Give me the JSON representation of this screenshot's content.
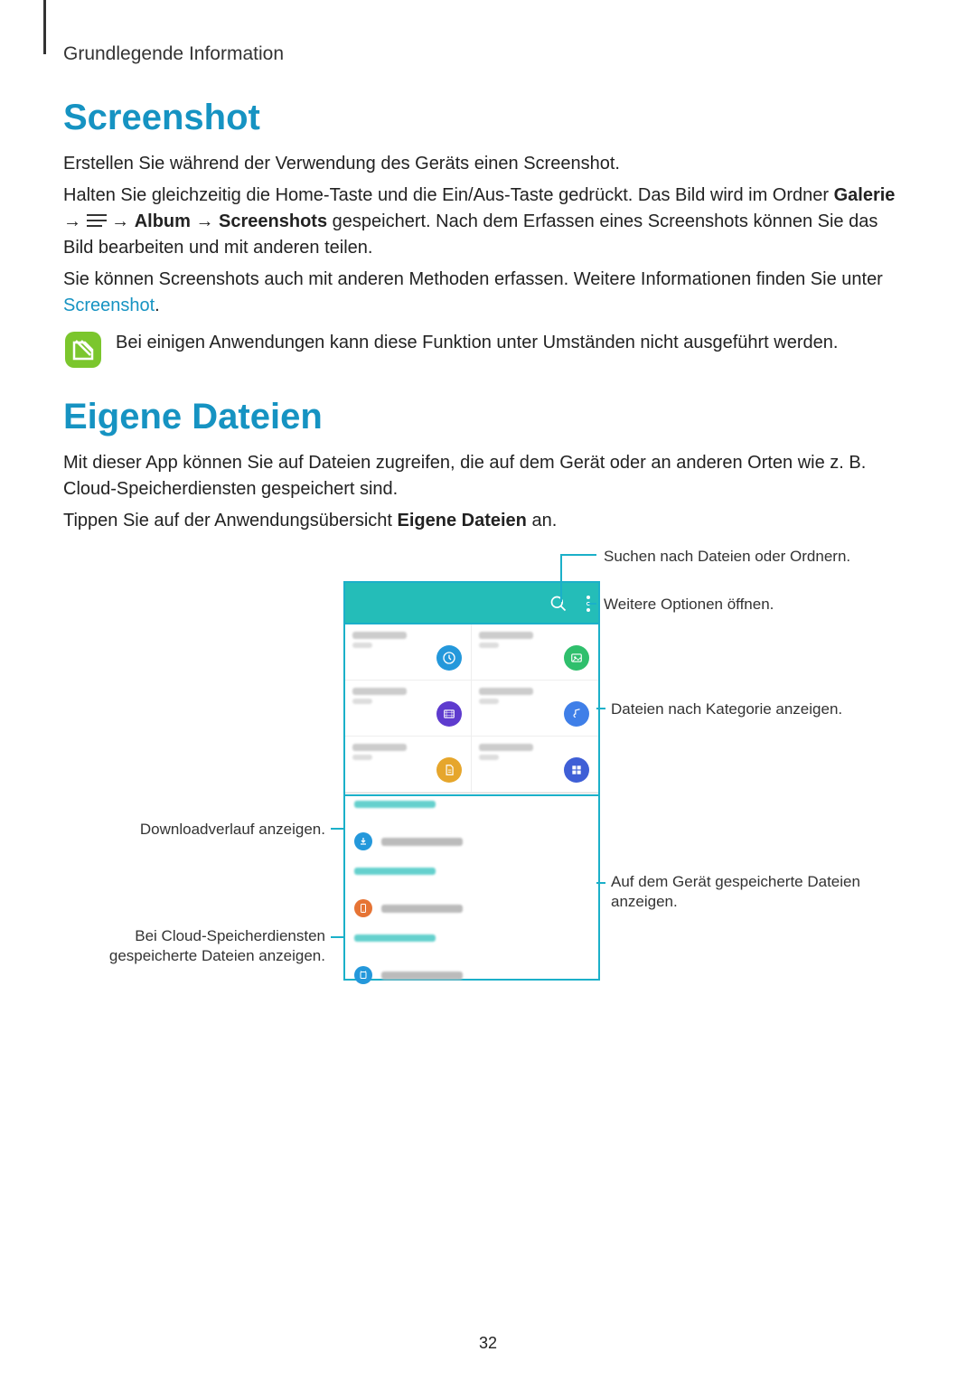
{
  "header": "Grundlegende Information",
  "section1": {
    "title": "Screenshot",
    "p1": "Erstellen Sie während der Verwendung des Geräts einen Screenshot.",
    "p2a": "Halten Sie gleichzeitig die Home-Taste und die Ein/Aus-Taste gedrückt. Das Bild wird im Ordner ",
    "p2b_bold": "Galerie",
    "p2_arrow": " → ",
    "p2c_bold": "Album",
    "p2d_bold": "Screenshots",
    "p2e": " gespeichert. Nach dem Erfassen eines Screenshots können Sie das Bild bearbeiten und mit anderen teilen.",
    "p3a": "Sie können Screenshots auch mit anderen Methoden erfassen. Weitere Informationen finden Sie unter ",
    "p3_link": "Screenshot",
    "p3b": ".",
    "note": "Bei einigen Anwendungen kann diese Funktion unter Umständen nicht ausgeführt werden."
  },
  "section2": {
    "title": "Eigene Dateien",
    "p1": "Mit dieser App können Sie auf Dateien zugreifen, die auf dem Gerät oder an anderen Orten wie z. B. Cloud-Speicherdiensten gespeichert sind.",
    "p2a": "Tippen Sie auf der Anwendungsübersicht ",
    "p2b_bold": "Eigene Dateien",
    "p2c": " an."
  },
  "callouts": {
    "search": "Suchen nach Dateien oder Ordnern.",
    "more": "Weitere Optionen öffnen.",
    "category": "Dateien nach Kategorie anzeigen.",
    "downloads": "Downloadverlauf anzeigen.",
    "device_a": "Auf dem Gerät gespeicherte Dateien",
    "device_b": "anzeigen.",
    "cloud_a": "Bei Cloud-Speicherdiensten",
    "cloud_b": "gespeicherte Dateien anzeigen."
  },
  "cat_colors": {
    "recent": "#2498db",
    "images": "#2fbf6c",
    "videos": "#5e3bce",
    "audio": "#3f7fe8",
    "documents": "#e6a62c",
    "downloaded": "#3f5fd6"
  },
  "item_colors": {
    "download": "#2498db",
    "device": "#e67435",
    "cloud": "#2498db"
  },
  "page_number": "32"
}
